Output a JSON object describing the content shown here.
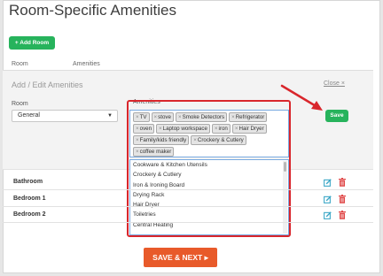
{
  "page": {
    "title": "Room-Specific Amenities"
  },
  "toolbar": {
    "add_room_label": "+ Add Room"
  },
  "table": {
    "col_room": "Room",
    "col_amenities": "Amenities"
  },
  "edit_panel": {
    "title": "Add / Edit Amenities",
    "close_label": "Close ×",
    "room_label": "Room",
    "room_value": "General",
    "amenities_label": "Amenities",
    "save_label": "Save",
    "selected_tags": [
      "TV",
      "stove",
      "Smoke Detectors",
      "Refrigerator",
      "oven",
      "Laptop workspace",
      "iron",
      "Hair Dryer",
      "Family/kids friendly",
      "Crockery & Cutlery",
      "coffee maker"
    ],
    "options": [
      "Cookware & Kitchen Utensils",
      "Crockery & Cutlery",
      "Iron & Ironing Board",
      "Drying Rack",
      "Hair Dryer",
      "Toiletries",
      "Central Heating"
    ]
  },
  "rooms": [
    "Bathroom",
    "Bedroom 1",
    "Bedroom 2"
  ],
  "footer": {
    "save_next_label": "SAVE & NEXT ▸"
  },
  "colors": {
    "green": "#27b35c",
    "orange": "#e85a2a",
    "highlight_red": "#d9262c",
    "edit_teal": "#3aa6c6",
    "trash_red": "#e04848"
  },
  "icons": {
    "edit": "edit-icon",
    "trash": "trash-icon",
    "arrow": "annotation-arrow",
    "caret": "chevron-down-icon"
  }
}
